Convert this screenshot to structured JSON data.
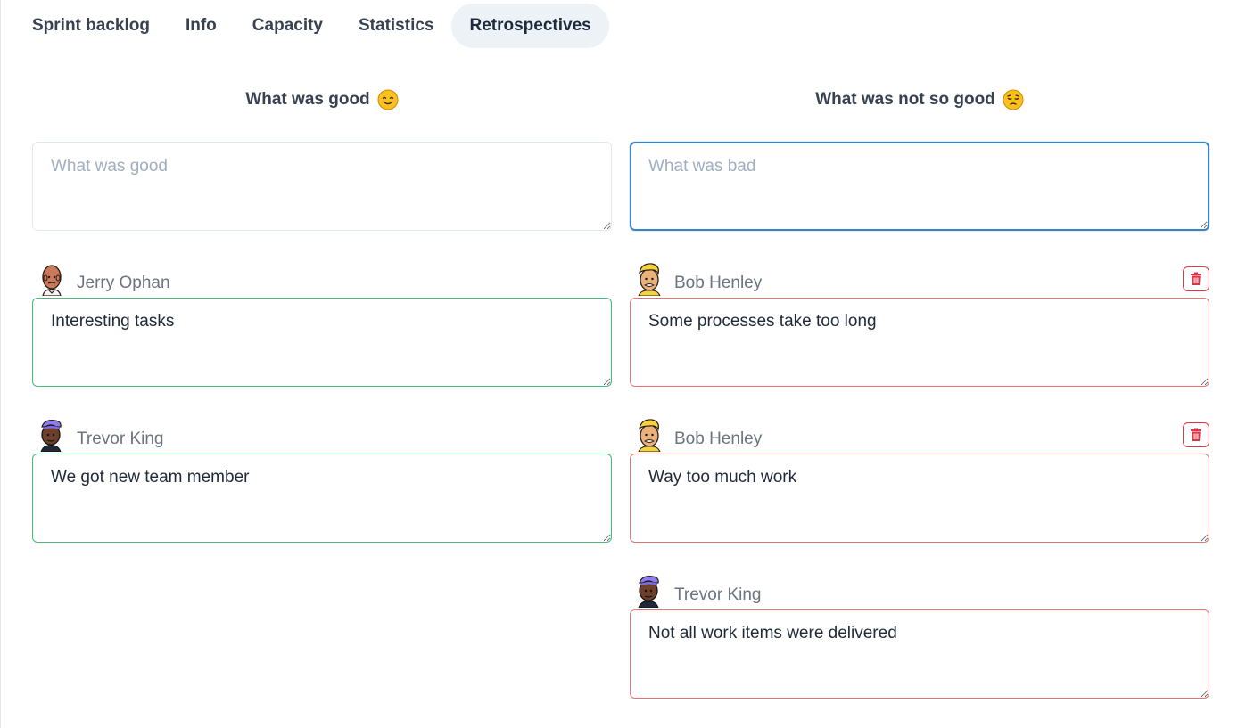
{
  "tabs": [
    {
      "label": "Sprint backlog",
      "active": false
    },
    {
      "label": "Info",
      "active": false
    },
    {
      "label": "Capacity",
      "active": false
    },
    {
      "label": "Statistics",
      "active": false
    },
    {
      "label": "Retrospectives",
      "active": true
    }
  ],
  "good": {
    "title": "What was good",
    "emoji": "smiling-face-icon",
    "placeholder": "What was good",
    "items": [
      {
        "author": "Jerry Ophan",
        "avatar": "avatar-jerry",
        "text": "Interesting tasks",
        "deletable": false
      },
      {
        "author": "Trevor King",
        "avatar": "avatar-trevor",
        "text": "We got new team member",
        "deletable": false
      }
    ]
  },
  "bad": {
    "title": "What was not so good",
    "emoji": "pensive-face-icon",
    "placeholder": "What was bad",
    "items": [
      {
        "author": "Bob Henley",
        "avatar": "avatar-bob",
        "text": "Some processes take too long",
        "deletable": true
      },
      {
        "author": "Bob Henley",
        "avatar": "avatar-bob",
        "text": "Way too much work",
        "deletable": true
      },
      {
        "author": "Trevor King",
        "avatar": "avatar-trevor",
        "text": "Not all work items were delivered",
        "deletable": false
      }
    ]
  },
  "colors": {
    "good_border": "#48bb78",
    "bad_border": "#e57373",
    "focus_border": "#3b82c4",
    "delete_red": "#dc3545"
  }
}
